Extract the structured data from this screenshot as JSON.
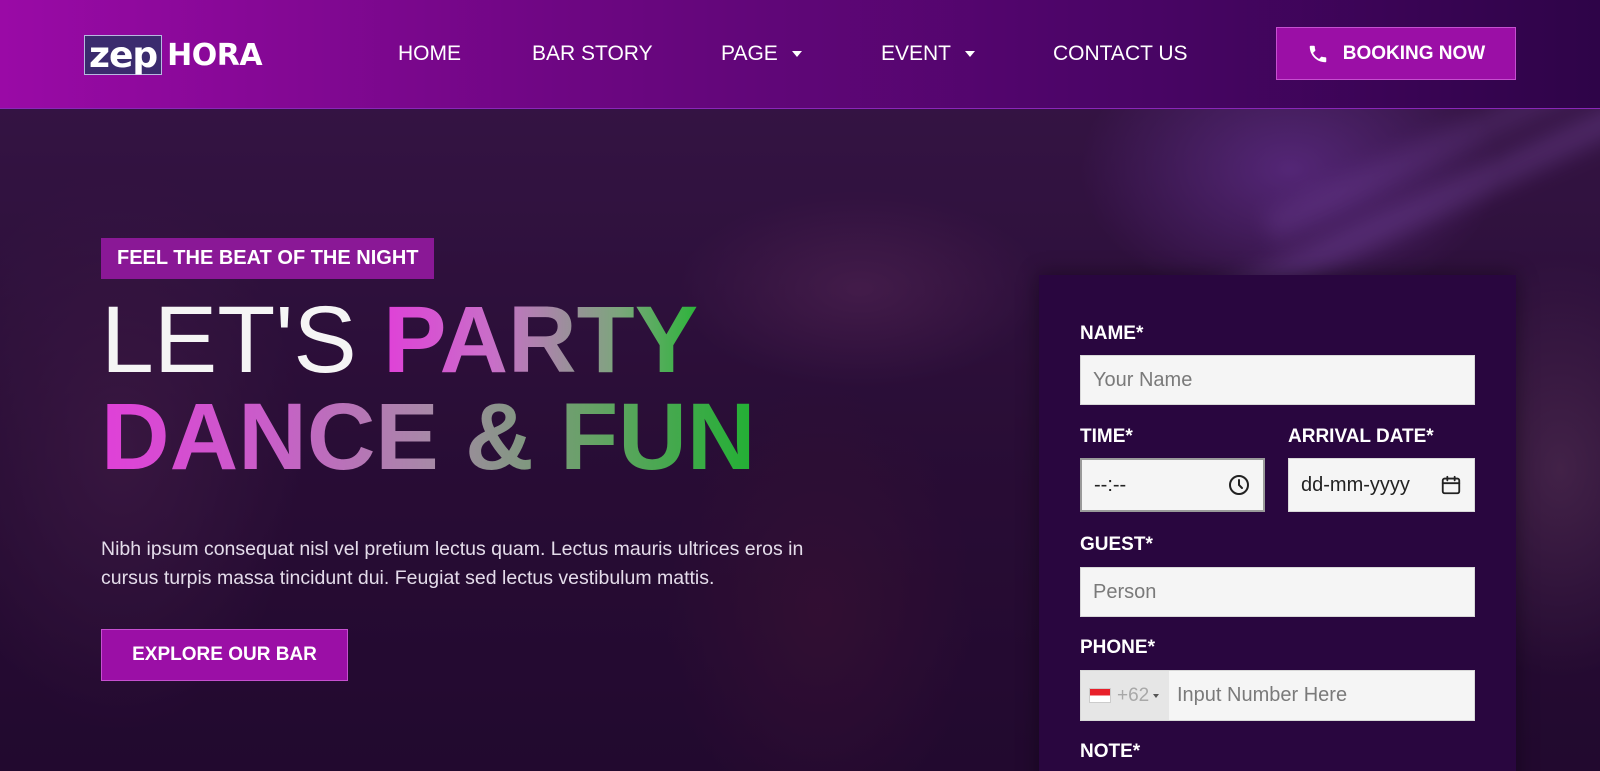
{
  "brand": {
    "logo_mark": "zep",
    "logo_word": "HORA"
  },
  "nav": {
    "items": [
      {
        "label": "HOME",
        "has_dropdown": false
      },
      {
        "label": "BAR STORY",
        "has_dropdown": false
      },
      {
        "label": "PAGE",
        "has_dropdown": true
      },
      {
        "label": "EVENT",
        "has_dropdown": true
      },
      {
        "label": "CONTACT US",
        "has_dropdown": false
      }
    ],
    "booking_button": {
      "label": "BOOKING NOW",
      "icon": "phone-icon"
    }
  },
  "hero": {
    "tagline": "FEEL THE BEAT OF THE NIGHT",
    "headline": {
      "part1": "LET'S",
      "part2": "PARTY",
      "line2": "DANCE & FUN"
    },
    "description": "Nibh ipsum consequat nisl vel pretium lectus quam. Lectus mauris ultrices eros in cursus turpis massa tincidunt dui. Feugiat sed lectus vestibulum mattis.",
    "cta_label": "EXPLORE OUR BAR"
  },
  "booking_form": {
    "name_label": "NAME*",
    "name_placeholder": "Your Name",
    "time_label": "TIME*",
    "time_value": "--:--",
    "time_icon": "clock-icon",
    "date_label": "ARRIVAL DATE*",
    "date_value": "dd-mm-yyyy",
    "date_icon": "calendar-icon",
    "guest_label": "GUEST*",
    "guest_placeholder": "Person",
    "phone_label": "PHONE*",
    "phone_country_code": "+62",
    "phone_country_flag": "indonesia-flag",
    "phone_placeholder": "Input Number Here",
    "note_label": "NOTE*"
  },
  "colors": {
    "accent": "#9b0fa6",
    "header_start": "#9a0aa6",
    "header_end": "#2e0448",
    "form_bg": "#29063f",
    "gradient_pink": "#e040d8",
    "gradient_green": "#22b034"
  }
}
